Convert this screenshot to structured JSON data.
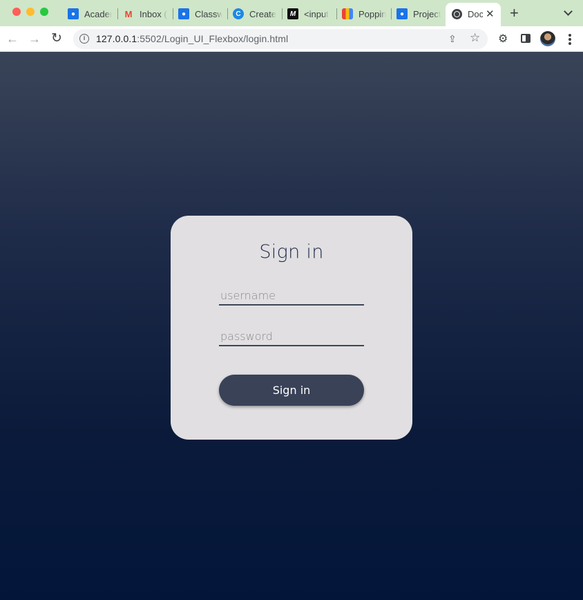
{
  "browser": {
    "tabs": [
      {
        "label": "Academ",
        "icon": "google-classroom-icon"
      },
      {
        "label": "Inbox (",
        "icon": "gmail-icon"
      },
      {
        "label": "Classw",
        "icon": "google-classroom-icon"
      },
      {
        "label": "Create",
        "icon": "chrome-c-icon"
      },
      {
        "label": "<input",
        "icon": "m-logo-icon"
      },
      {
        "label": "Poppin",
        "icon": "google-fonts-icon"
      },
      {
        "label": "Project",
        "icon": "google-classroom-icon"
      }
    ],
    "active_tab": {
      "label": "Doc",
      "icon": "globe-icon"
    },
    "url": {
      "host": "127.0.0.1",
      "rest": ":5502/Login_UI_Flexbox/login.html"
    }
  },
  "login": {
    "title": "Sign in",
    "username_placeholder": "username",
    "password_placeholder": "password",
    "button_label": "Sign in"
  }
}
